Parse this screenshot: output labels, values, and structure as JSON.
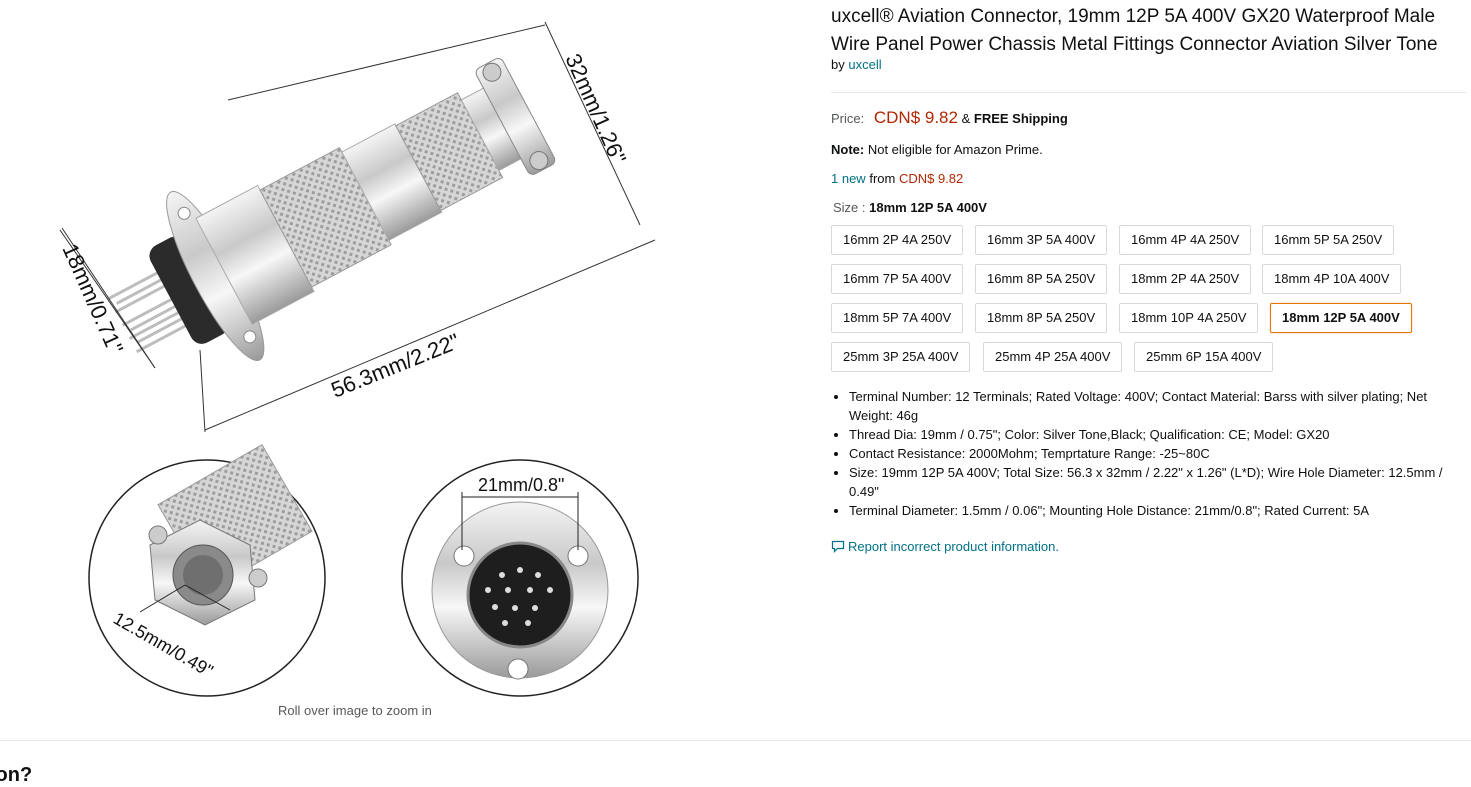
{
  "gallery": {
    "dim_top": "32mm/1.26\"",
    "dim_left": "18mm/0.71\"",
    "dim_length": "56.3mm/2.22\"",
    "dim_hole": "12.5mm/0.49\"",
    "dim_mount": "21mm/0.8\"",
    "zoom_hint": "Roll over image to zoom in"
  },
  "product": {
    "title": "uxcell® Aviation Connector, 19mm 12P 5A 400V GX20 Waterproof Male Wire Panel Power Chassis Metal Fittings Connector Aviation Silver Tone",
    "by_label": "by",
    "brand": "uxcell",
    "price_label": "Price:",
    "price": "CDN$ 9.82",
    "shipping_amp": "&",
    "shipping": "FREE Shipping",
    "note_label": "Note:",
    "note_text": "Not eligible for Amazon Prime.",
    "offers_count": "1 new",
    "offers_from": "from",
    "offers_price": "CDN$ 9.82",
    "size_label": "Size :",
    "size_selected": "18mm 12P 5A 400V",
    "sizes": [
      "16mm 2P 4A 250V",
      "16mm 3P 5A 400V",
      "16mm 4P 4A 250V",
      "16mm 5P 5A 250V",
      "16mm 7P 5A 400V",
      "16mm 8P 5A 250V",
      "18mm 2P 4A 250V",
      "18mm 4P 10A 400V",
      "18mm 5P 7A 400V",
      "18mm 8P 5A 250V",
      "18mm 10P 4A 250V",
      "18mm 12P 5A 400V",
      "25mm 3P 25A 400V",
      "25mm 4P 25A 400V",
      "25mm 6P 15A 400V"
    ],
    "bullets": [
      "Terminal Number: 12 Terminals; Rated Voltage: 400V; Contact Material: Barss with silver plating; Net Weight: 46g",
      "Thread Dia: 19mm / 0.75\"; Color: Silver Tone,Black; Qualification: CE; Model: GX20",
      "Contact Resistance: 2000Mohm; Temprtature Range: -25~80C",
      "Size: 19mm 12P 5A 400V; Total Size: 56.3 x 32mm / 2.22\" x 1.26\" (L*D); Wire Hole Diameter: 12.5mm / 0.49\"",
      "Terminal Diameter: 1.5mm / 0.06\"; Mounting Hole Distance: 21mm/0.8\"; Rated Current: 5A"
    ],
    "report_link": "Report incorrect product information."
  },
  "section_heading_partial": "ion?",
  "colors": {
    "link": "#007185",
    "price": "#B12704",
    "selected_border": "#E77600"
  }
}
